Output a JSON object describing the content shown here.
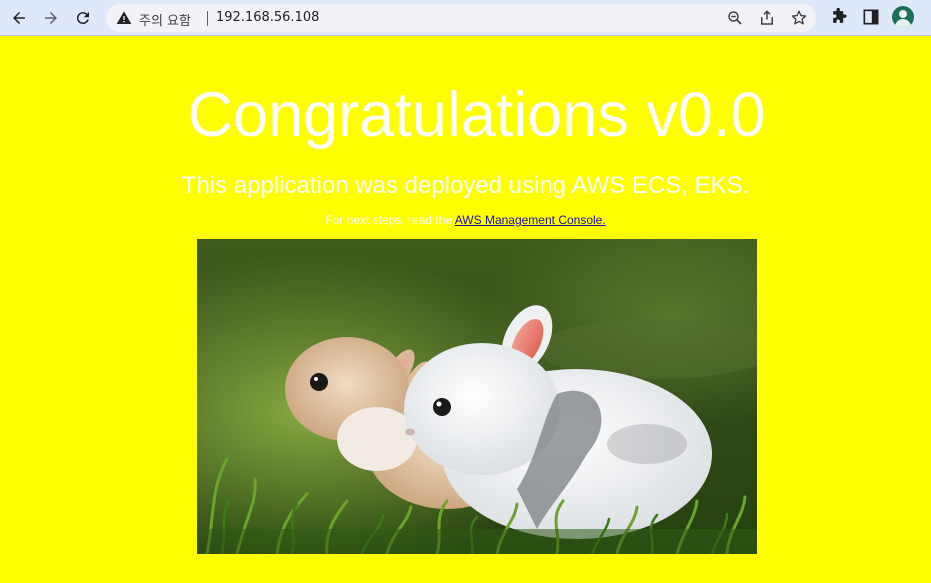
{
  "browser": {
    "security_warning": "주의 요함",
    "url": "192.168.56.108",
    "icons": [
      "back-icon",
      "forward-icon",
      "reload-icon",
      "warning-icon",
      "zoom-icon",
      "share-icon",
      "bookmark-star-icon",
      "extensions-icon",
      "side-panel-icon",
      "profile-avatar"
    ]
  },
  "page": {
    "background_color": "#ffff00",
    "heading": "Congratulations v0.0",
    "subheading": "This application was deployed using AWS ECS, EKS.",
    "note_prefix": "For next steps, read the ",
    "note_link": "AWS Management Console."
  }
}
